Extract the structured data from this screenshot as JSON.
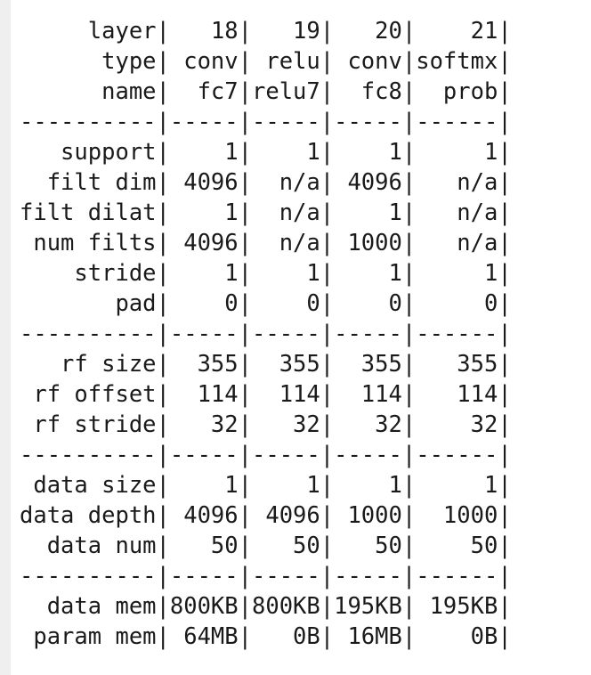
{
  "header_rows": [
    {
      "label": "layer",
      "values": [
        "18",
        "19",
        "20",
        "21"
      ]
    },
    {
      "label": "type",
      "values": [
        "conv",
        "relu",
        "conv",
        "softmx"
      ]
    },
    {
      "label": "name",
      "values": [
        "fc7",
        "relu7",
        "fc8",
        "prob"
      ]
    }
  ],
  "sections": [
    [
      {
        "label": "support",
        "values": [
          "1",
          "1",
          "1",
          "1"
        ]
      },
      {
        "label": "filt dim",
        "values": [
          "4096",
          "n/a",
          "4096",
          "n/a"
        ]
      },
      {
        "label": "filt dilat",
        "values": [
          "1",
          "n/a",
          "1",
          "n/a"
        ]
      },
      {
        "label": "num filts",
        "values": [
          "4096",
          "n/a",
          "1000",
          "n/a"
        ]
      },
      {
        "label": "stride",
        "values": [
          "1",
          "1",
          "1",
          "1"
        ]
      },
      {
        "label": "pad",
        "values": [
          "0",
          "0",
          "0",
          "0"
        ]
      }
    ],
    [
      {
        "label": "rf size",
        "values": [
          "355",
          "355",
          "355",
          "355"
        ]
      },
      {
        "label": "rf offset",
        "values": [
          "114",
          "114",
          "114",
          "114"
        ]
      },
      {
        "label": "rf stride",
        "values": [
          "32",
          "32",
          "32",
          "32"
        ]
      }
    ],
    [
      {
        "label": "data size",
        "values": [
          "1",
          "1",
          "1",
          "1"
        ]
      },
      {
        "label": "data depth",
        "values": [
          "4096",
          "4096",
          "1000",
          "1000"
        ]
      },
      {
        "label": "data num",
        "values": [
          "50",
          "50",
          "50",
          "50"
        ]
      }
    ],
    [
      {
        "label": "data mem",
        "values": [
          "800KB",
          "800KB",
          "195KB",
          "195KB"
        ]
      },
      {
        "label": "param mem",
        "values": [
          "64MB",
          "0B",
          "16MB",
          "0B"
        ]
      }
    ]
  ]
}
